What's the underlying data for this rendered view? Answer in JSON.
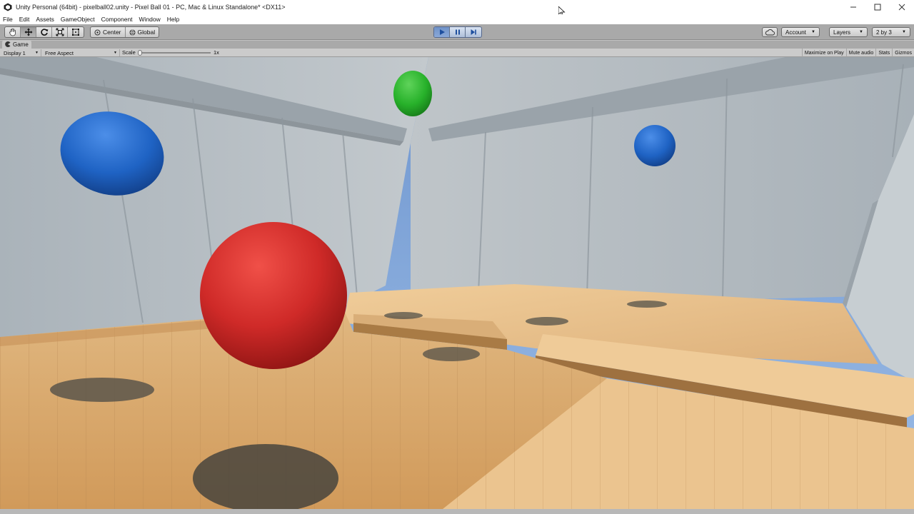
{
  "window": {
    "title": "Unity Personal (64bit) - pixelball02.unity - Pixel Ball 01 - PC, Mac & Linux Standalone* <DX11>",
    "controls": [
      "minimize",
      "maximize",
      "close"
    ]
  },
  "menu": [
    "File",
    "Edit",
    "Assets",
    "GameObject",
    "Component",
    "Window",
    "Help"
  ],
  "toolbar": {
    "transform_tools": [
      "hand-icon",
      "move-icon",
      "rotate-icon",
      "scale-icon",
      "rect-icon"
    ],
    "active_tool_index": 1,
    "pivot_label": "Center",
    "space_label": "Global",
    "playback": {
      "play_active": true,
      "pause_active": false
    },
    "account_label": "Account",
    "layers_label": "Layers",
    "layout_label": "2 by 3"
  },
  "game_tab": {
    "label": "Game",
    "display": "Display 1",
    "aspect": "Free Aspect",
    "scale_label": "Scale",
    "scale_value": "1x",
    "scale_fraction": 0.0,
    "toggles": [
      "Maximize on Play",
      "Mute audio",
      "Stats",
      "Gizmos"
    ]
  },
  "scene": {
    "balls": [
      {
        "name": "red-ball",
        "color": "#d22a28"
      },
      {
        "name": "blue-ball-left",
        "color": "#1f63c4"
      },
      {
        "name": "green-ball",
        "color": "#27b12a"
      },
      {
        "name": "blue-ball-right",
        "color": "#1f5fc2"
      }
    ],
    "floor_color": "#d9a86a",
    "wall_color": "#b9c0c5",
    "sky_color": "#7ea4da"
  },
  "colors": {
    "toolbar_bg": "#a9a9a9",
    "play_accent": "#3b72c4"
  }
}
